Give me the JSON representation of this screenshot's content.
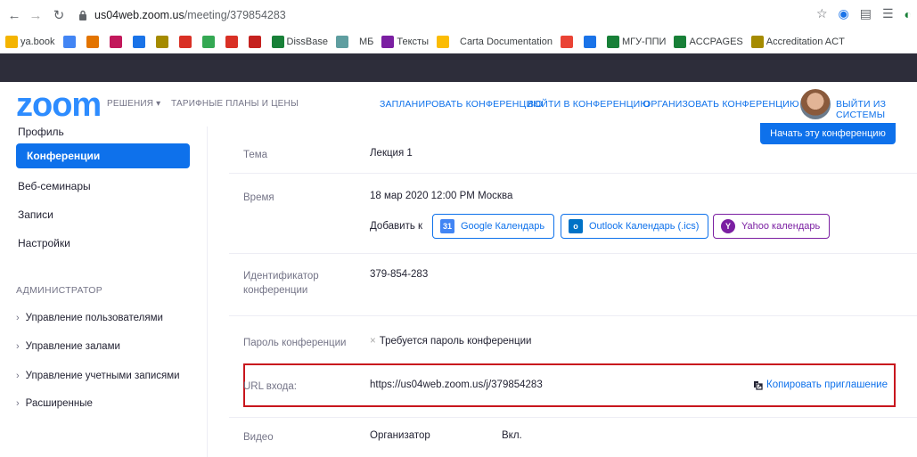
{
  "browser": {
    "url_host": "us04web.zoom.us",
    "url_path": "/meeting/379854283",
    "bookmarks": [
      {
        "label": "ya.book",
        "color": "#f4b400"
      },
      {
        "label": "",
        "color": "#4285f4"
      },
      {
        "label": "",
        "color": "#e37400"
      },
      {
        "label": "",
        "color": "#c2185b"
      },
      {
        "label": "",
        "color": "#1a73e8"
      },
      {
        "label": "",
        "color": "#a58b00"
      },
      {
        "label": "",
        "color": "#d93025"
      },
      {
        "label": "",
        "color": "#34a853"
      },
      {
        "label": "",
        "color": "#d93025"
      },
      {
        "label": "",
        "color": "#c5221f"
      },
      {
        "label": "DissBase",
        "color": "#188038"
      },
      {
        "label": "",
        "color": "#5f9ea0"
      },
      {
        "label": "МБ",
        "color": ""
      },
      {
        "label": "Тексты",
        "color": "#7b1fa2"
      },
      {
        "label": "",
        "color": "#fbbc04"
      },
      {
        "label": "Carta Documentation",
        "color": ""
      },
      {
        "label": "",
        "color": "#ea4335"
      },
      {
        "label": "",
        "color": "#1a73e8"
      },
      {
        "label": "МГУ-ППИ",
        "color": "#188038"
      },
      {
        "label": "ACCPAGES",
        "color": "#188038"
      },
      {
        "label": "Accreditation ACT",
        "color": "#a58b00"
      }
    ]
  },
  "header": {
    "logo": "zoom",
    "nav_solutions": "РЕШЕНИЯ ▾",
    "nav_plans": "ТАРИФНЫЕ ПЛАНЫ И ЦЕНЫ",
    "nav_schedule": "ЗАПЛАНИРОВАТЬ КОНФЕРЕНЦИЮ",
    "nav_join": "ВОЙТИ В КОНФЕРЕНЦИЮ",
    "nav_host": "ОРГАНИЗОВАТЬ КОНФЕРЕНЦИЮ ▾",
    "nav_signout": "ВЫЙТИ ИЗ СИСТЕМЫ"
  },
  "sidebar": {
    "profile": "Профиль",
    "meetings": "Конференции",
    "webinars": "Веб-семинары",
    "recordings": "Записи",
    "settings": "Настройки",
    "admin_section": "АДМИНИСТРАТОР",
    "groups": [
      "Управление пользователями",
      "Управление залами",
      "Управление учетными записями",
      "Расширенные"
    ]
  },
  "meeting": {
    "start_button": "Начать эту конференцию",
    "topic_label": "Тема",
    "topic_value": "Лекция 1",
    "time_label": "Время",
    "time_value": "18 мар 2020 12:00 PM Москва",
    "add_to_label": "Добавить к",
    "google_cal": "Google Календарь",
    "outlook_cal": "Outlook Календарь (.ics)",
    "yahoo_cal": "Yahoo календарь",
    "id_label": "Идентификатор конференции",
    "id_value": "379-854-283",
    "password_label": "Пароль конференции",
    "password_value": "Требуется пароль конференции",
    "join_url_label": "URL входа:",
    "join_url_value": "https://us04web.zoom.us/j/379854283",
    "copy_invite": "Копировать приглашение",
    "video_label": "Видео",
    "video_host": "Организатор",
    "video_host_value": "Вкл."
  },
  "colors": {
    "accent": "#0e71eb",
    "highlight_box": "#c8161d",
    "google": "#4285f4",
    "outlook": "#0072c6",
    "yahoo": "#7b1fa2"
  }
}
